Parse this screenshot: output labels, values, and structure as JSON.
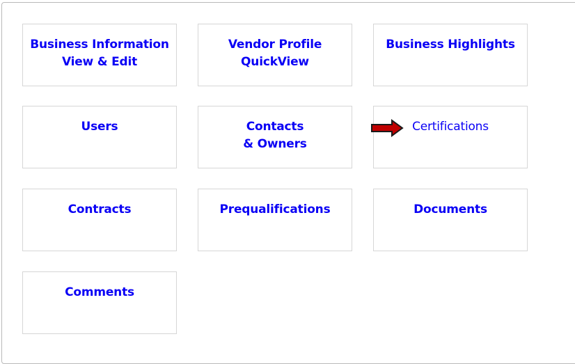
{
  "tiles": {
    "business_information": "Business Information\nView & Edit",
    "vendor_profile": "Vendor Profile\nQuickView",
    "business_highlights": "Business Highlights",
    "users": "Users",
    "contacts_owners": "Contacts\n& Owners",
    "certifications": "Certifications",
    "contracts": "Contracts",
    "prequalifications": "Prequalifications",
    "documents": "Documents",
    "comments": "Comments"
  },
  "annotation": {
    "arrow_icon": "right-arrow-icon",
    "arrow_color": "#c00000"
  },
  "colors": {
    "link": "#0a00f5",
    "tile_border": "#d6d6d6",
    "frame_border": "#b9b9b9"
  }
}
